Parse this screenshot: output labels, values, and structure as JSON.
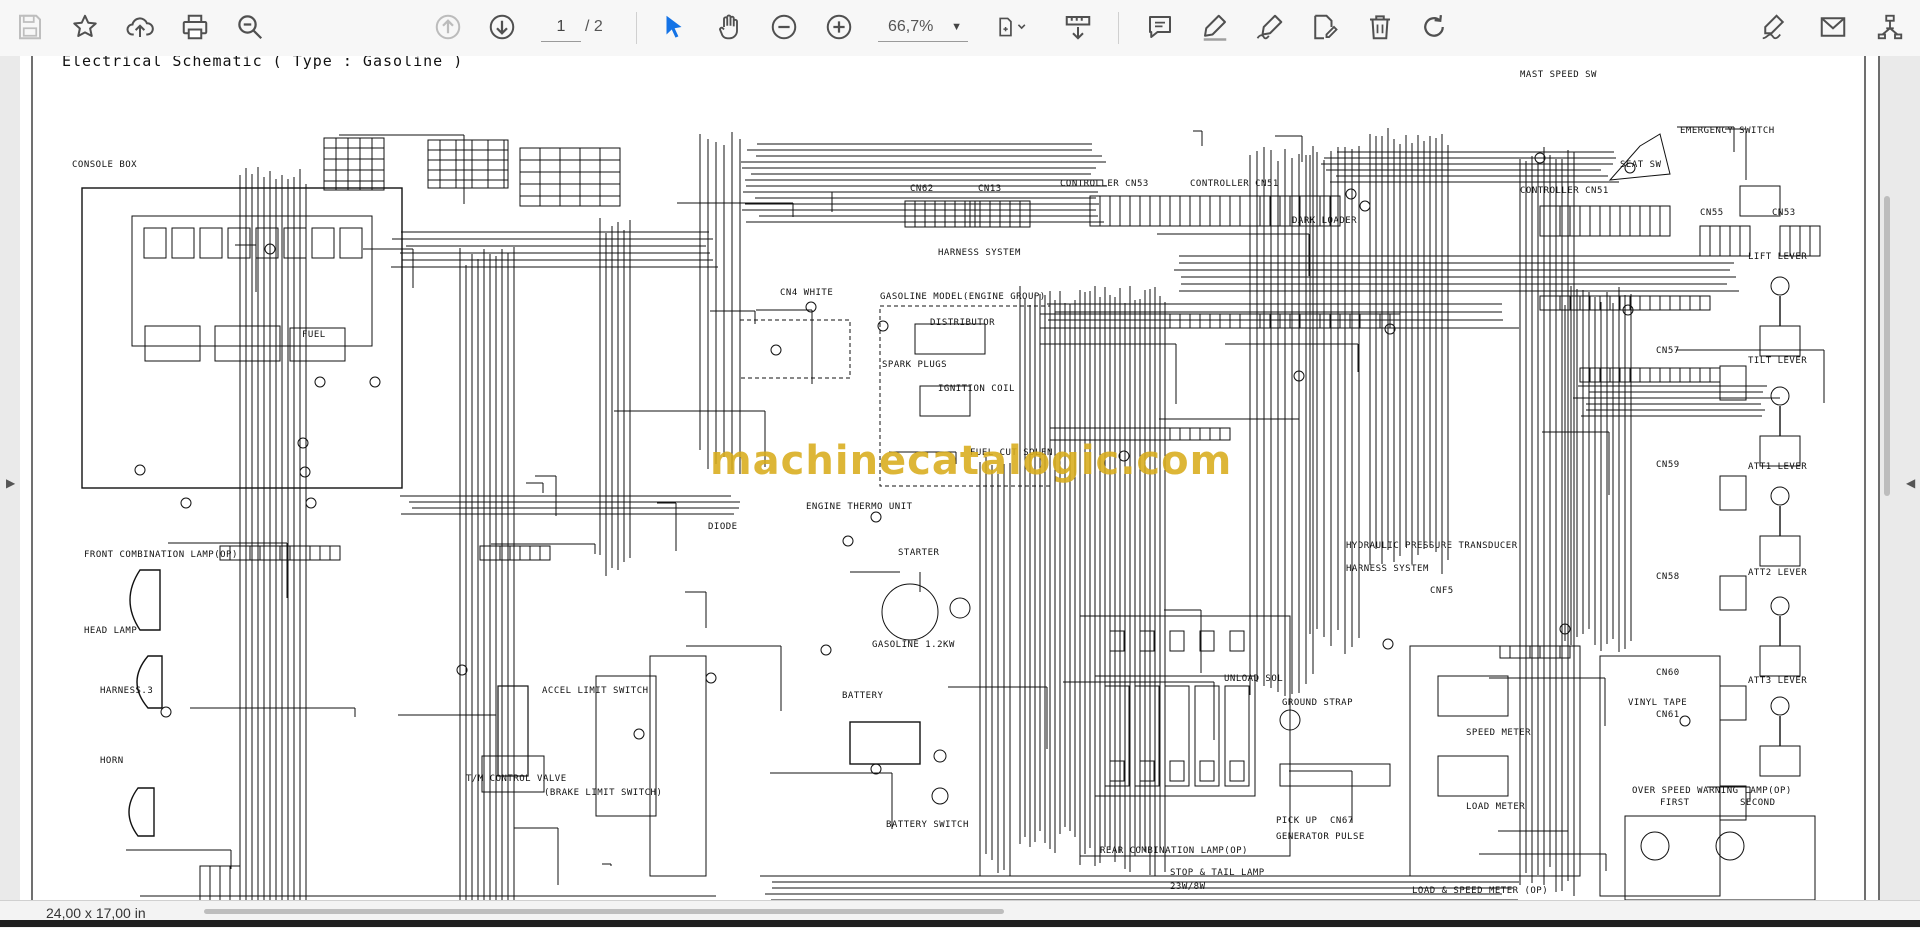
{
  "toolbar": {
    "page_current": "1",
    "page_total": "/ 2",
    "zoom": "66,7%",
    "icons": [
      "save-icon",
      "bookmark-star-icon",
      "upload-icon",
      "print-icon",
      "zoom-search-icon",
      "page-up-icon",
      "page-down-icon",
      "select-cursor-icon",
      "hand-icon",
      "zoom-out-icon",
      "zoom-in-icon",
      "page-fit-icon",
      "scroll-mode-icon",
      "comment-icon",
      "highlight-icon",
      "draw-icon",
      "stamp-icon",
      "delete-icon",
      "rotate-icon",
      "sign-icon",
      "email-icon",
      "share-icon"
    ]
  },
  "document": {
    "title": "Electrical Schematic ( Type : Gasoline )",
    "watermark": "machinecatalogic.com",
    "labels": {
      "console_box": "CONSOLE BOX",
      "mast_speed_sw": "MAST SPEED SW",
      "emergency_switch": "EMERGENCY SWITCH",
      "seat_sw": "SEAT SW",
      "controller_cn3": "CONTROLLER CN53",
      "controller_cn1": "CONTROLLER CN51",
      "controller_cn51": "CONTROLLER CN51",
      "cn62": "CN62",
      "cn13": "CN13",
      "cn55": "CN55",
      "cn53": "CN53",
      "lift_lever": "LIFT LEVER",
      "tilt_lever": "TILT LEVER",
      "att1_lever": "ATT1 LEVER",
      "att2_lever": "ATT2 LEVER",
      "att3_lever": "ATT3 LEVER",
      "harness_system": "HARNESS SYSTEM",
      "gasoline_model": "GASOLINE MODEL(ENGINE GROUP)",
      "distributor": "DISTRIBUTOR",
      "spark_plugs": "SPARK PLUGS",
      "ignition_coil": "IGNITION COIL",
      "fuel_cut_solenoid": "FUEL CUT SOLEN",
      "cn4_white": "CN4 WHITE",
      "engine_thermo_unit": "ENGINE THERMO UNIT",
      "starter": "STARTER",
      "gasoline": "GASOLINE 1.2KW",
      "battery": "BATTERY",
      "battery_switch": "BATTERY SWITCH",
      "head_lamp": "HEAD LAMP",
      "horn": "HORN",
      "harness3": "HARNESS.3",
      "front_combination": "FRONT COMBINATION LAMP(OP)",
      "accel_limit": "ACCEL LIMIT SWITCH",
      "tm_control_valve": "T/M CONTROL VALVE",
      "brake_limit": "(BRAKE LIMIT SWITCH)",
      "diode": "DIODE",
      "hydraulic_pressure": "HYDRAULIC PRESSURE TRANSDUCER",
      "harness_system2": "HARNESS SYSTEM",
      "cnf5": "CNF5",
      "unload_sol": "UNLOAD SOL",
      "ground_strap": "GROUND STRAP",
      "pick_up": "PICK UP",
      "cn67": "CN67",
      "generator_pulse": "GENERATOR PULSE",
      "rear_combination": "REAR COMBINATION LAMP(OP)",
      "stop_tail": "STOP & TAIL LAMP",
      "lamp_rating": "23W/8W",
      "speed_meter": "SPEED METER",
      "load_meter": "LOAD METER",
      "load_speed_meter": "LOAD & SPEED METER (OP)",
      "over_speed": "OVER SPEED WARNING LAMP(OP)",
      "first": "FIRST",
      "second": "SECOND",
      "vinyl_tape": "VINYL TAPE",
      "dark_loader": "DARK LOADER",
      "fuel": "FUEL",
      "cn58": "CN58",
      "cn60": "CN60",
      "cn61": "CN61",
      "cn57": "CN57",
      "cn59": "CN59"
    }
  },
  "status": {
    "page_size": "24,00 x 17,00 in"
  },
  "colors": {
    "watermark": "#d9ad1c",
    "toolbar_bg": "#f7f7f7",
    "viewer_bg": "#6d6d6d",
    "select_accent": "#1473e6"
  }
}
